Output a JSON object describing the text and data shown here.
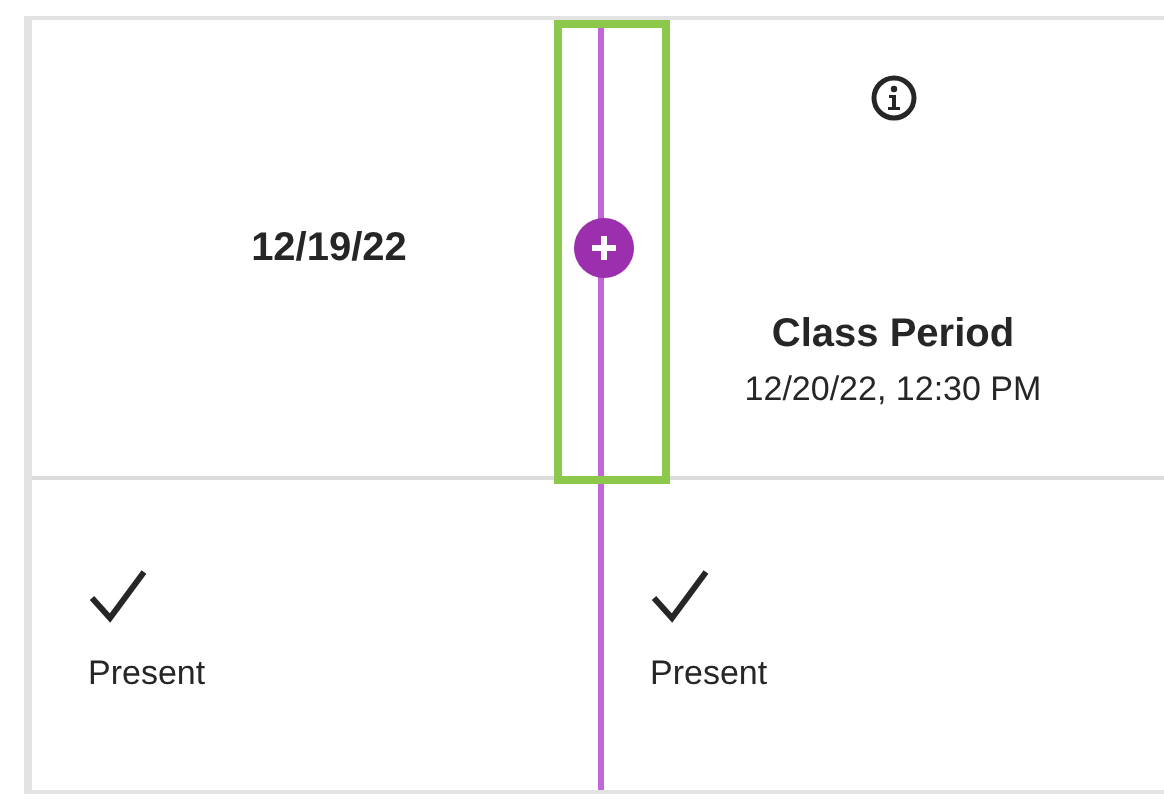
{
  "columns": [
    {
      "kind": "date",
      "date": "12/19/22"
    },
    {
      "kind": "session",
      "title": "Class Period",
      "datetime": "12/20/22, 12:30 PM"
    }
  ],
  "rows": [
    {
      "cells": [
        {
          "kind": "present",
          "status": "Present"
        },
        {
          "kind": "present",
          "status": "Present"
        }
      ]
    }
  ]
}
